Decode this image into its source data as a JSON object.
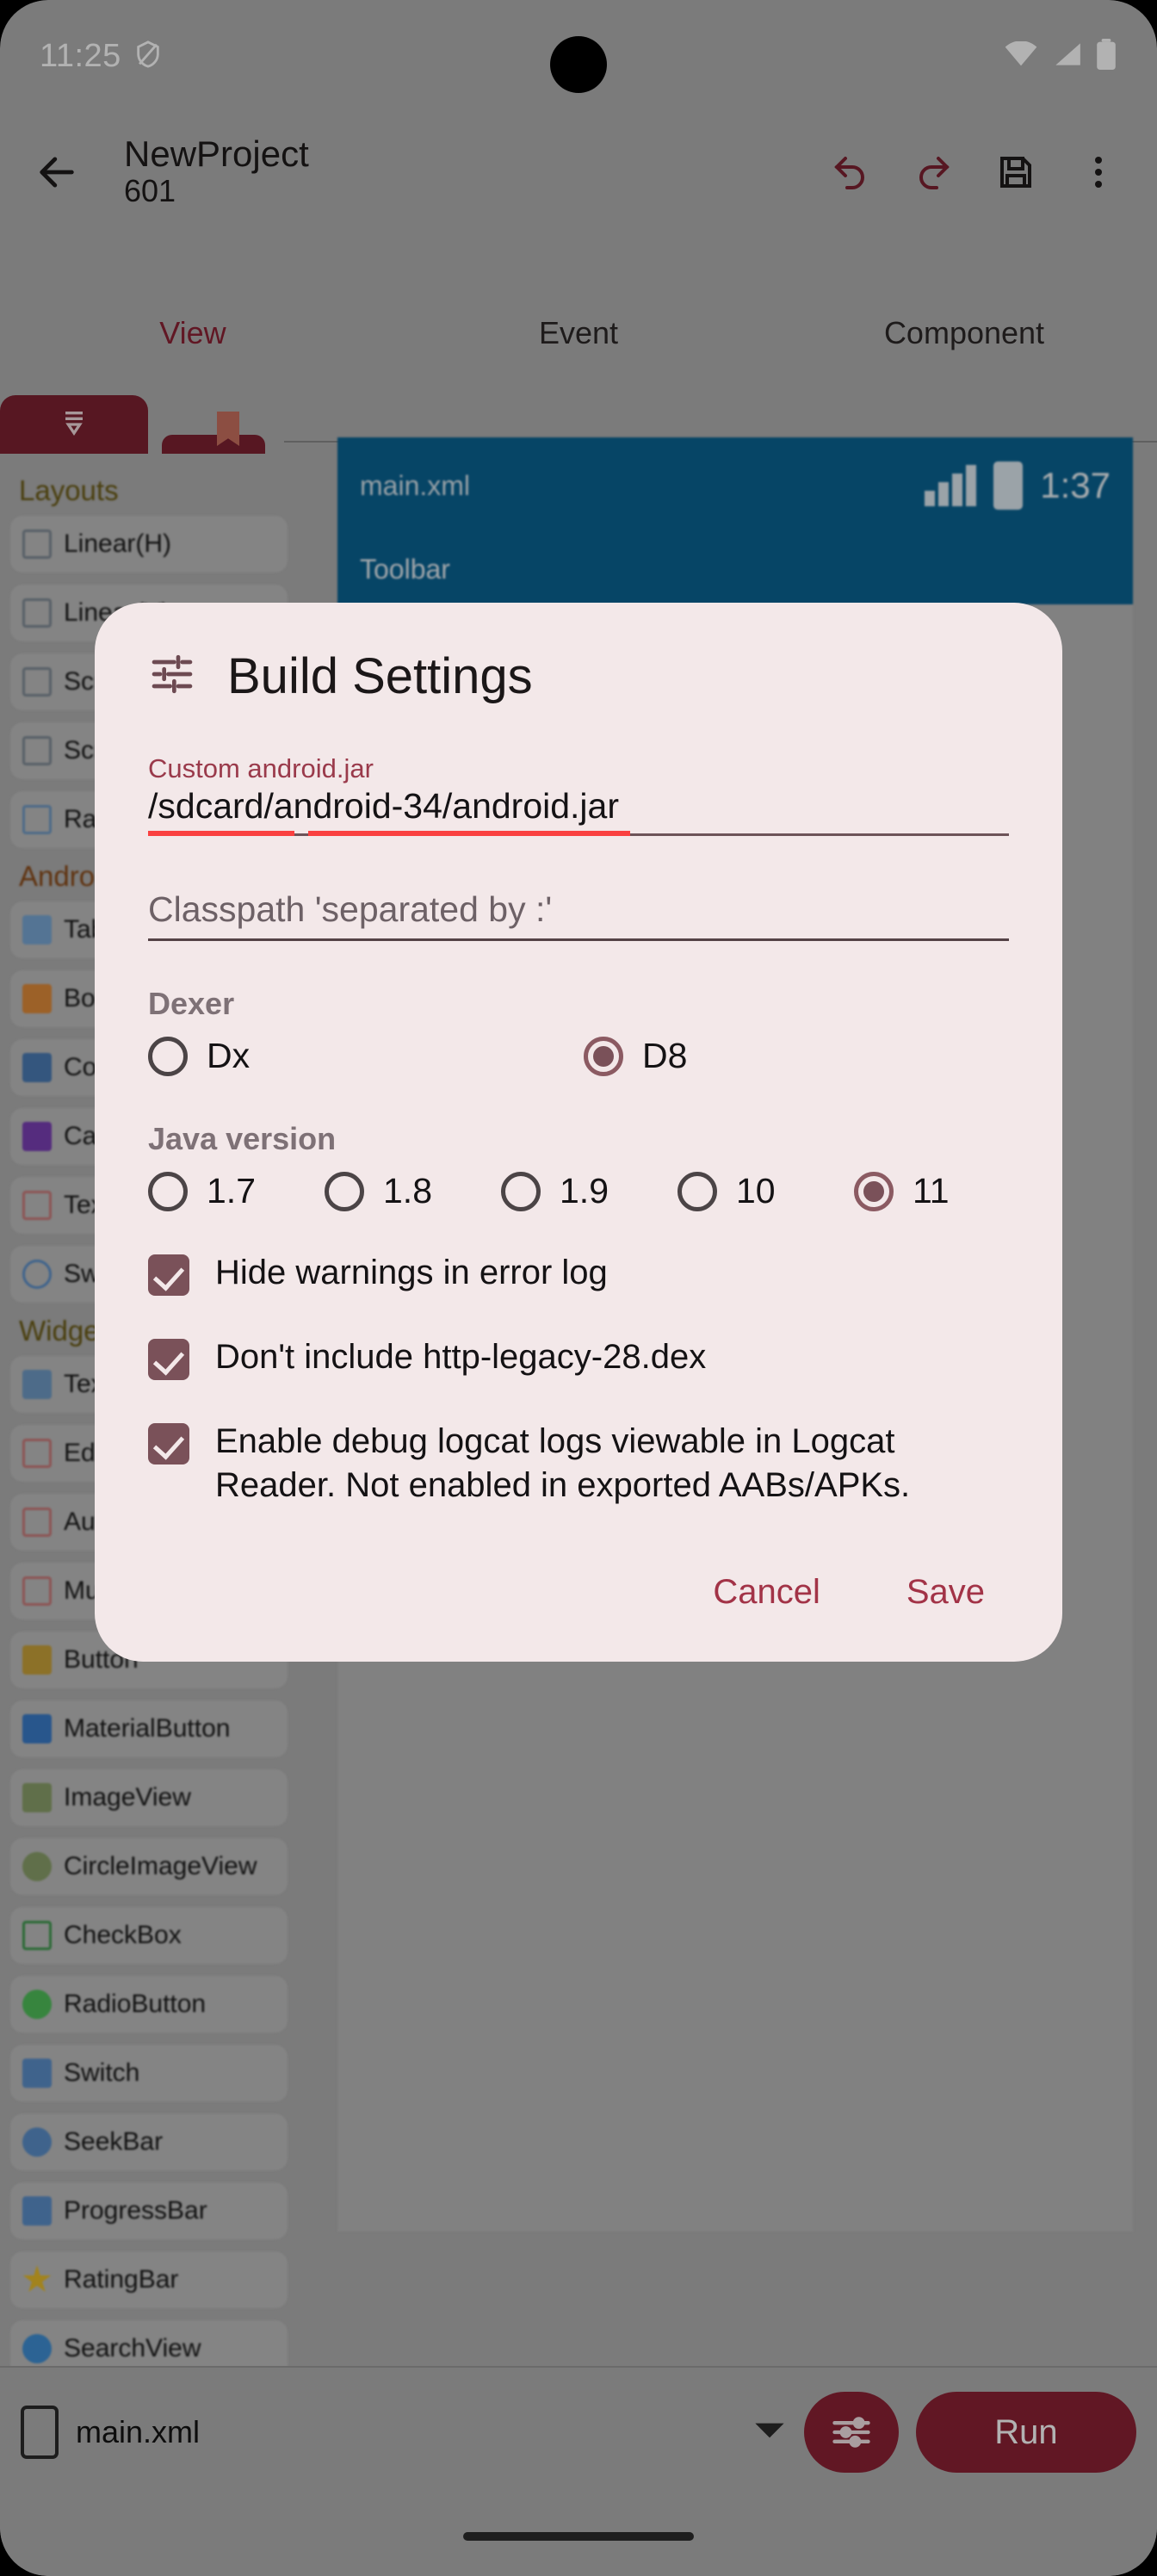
{
  "statusbar": {
    "time": "11:25",
    "shield_icon": "shield-icon",
    "wifi_icon": "wifi-icon",
    "signal_icon": "signal-icon",
    "battery_icon": "battery-icon"
  },
  "toolbar": {
    "back_icon": "back-arrow-icon",
    "project_name": "NewProject",
    "project_sub": "601",
    "undo_icon": "undo-icon",
    "redo_icon": "redo-icon",
    "save_icon": "save-disk-icon",
    "overflow_icon": "more-vert-icon"
  },
  "tabs": [
    {
      "label": "View",
      "active": true
    },
    {
      "label": "Event",
      "active": false
    },
    {
      "label": "Component",
      "active": false
    }
  ],
  "palette": {
    "layouts_header": "Layouts",
    "layouts": [
      {
        "label": "Linear(H)",
        "icon": "linear-horizontal-icon"
      },
      {
        "label": "Linear(V)",
        "icon": "linear-vertical-icon"
      },
      {
        "label": "ScrollView(H)",
        "icon": "scroll-h-icon"
      },
      {
        "label": "ScrollView(V)",
        "icon": "scroll-v-icon"
      },
      {
        "label": "RadioGroup",
        "icon": "radiogroup-icon"
      }
    ],
    "androidx_header": "AndroidX",
    "androidx": [
      {
        "label": "TabLayout",
        "icon": "tab-icon"
      },
      {
        "label": "BottomNavigationView",
        "icon": "home-icon"
      },
      {
        "label": "ComposeView android",
        "icon": "compose-icon"
      },
      {
        "label": "CardView",
        "icon": "card-icon"
      },
      {
        "label": "TextInputLayout",
        "icon": "textinput-icon"
      },
      {
        "label": "SwipeRefreshLayout",
        "icon": "swiperefresh-icon"
      }
    ],
    "widgets_header": "Widgets",
    "widgets": [
      {
        "label": "TextView",
        "icon": "textview-icon"
      },
      {
        "label": "EditText",
        "icon": "edittext-icon"
      },
      {
        "label": "AutoCompleteTextView",
        "icon": "autocomplete-icon"
      },
      {
        "label": "MultiAutoCompleteTextView",
        "icon": "multiautocomplete-icon"
      },
      {
        "label": "Button",
        "icon": "button-icon"
      },
      {
        "label": "MaterialButton",
        "icon": "material-button-icon"
      },
      {
        "label": "ImageView",
        "icon": "imageview-icon"
      },
      {
        "label": "CircleImageView",
        "icon": "circleimage-icon"
      },
      {
        "label": "CheckBox",
        "icon": "checkbox-icon"
      },
      {
        "label": "RadioButton",
        "icon": "radiobutton-icon"
      },
      {
        "label": "Switch",
        "icon": "switch-icon"
      },
      {
        "label": "SeekBar",
        "icon": "seekbar-icon"
      },
      {
        "label": "ProgressBar",
        "icon": "progressbar-icon"
      },
      {
        "label": "RatingBar",
        "icon": "ratingbar-icon"
      },
      {
        "label": "SearchView",
        "icon": "searchview-icon"
      }
    ]
  },
  "preview": {
    "filename": "main.xml",
    "clock": "1:37",
    "toolbar_label": "Toolbar"
  },
  "dialog": {
    "icon": "tune-sliders-icon",
    "title": "Build Settings",
    "custom_jar": {
      "label": "Custom android.jar",
      "value": "/sdcard/android-34/android.jar"
    },
    "classpath": {
      "placeholder": "Classpath 'separated by :'",
      "value": ""
    },
    "dexer": {
      "label": "Dexer",
      "options": [
        {
          "label": "Dx",
          "selected": false
        },
        {
          "label": "D8",
          "selected": true
        }
      ]
    },
    "java_version": {
      "label": "Java version",
      "options": [
        {
          "label": "1.7",
          "selected": false
        },
        {
          "label": "1.8",
          "selected": false
        },
        {
          "label": "1.9",
          "selected": false
        },
        {
          "label": "10",
          "selected": false
        },
        {
          "label": "11",
          "selected": true
        }
      ]
    },
    "checkboxes": [
      {
        "label": "Hide warnings in error log",
        "checked": true
      },
      {
        "label": "Don't include http-legacy-28.dex",
        "checked": true
      },
      {
        "label": "Enable debug logcat logs viewable in Logcat Reader. Not enabled in exported AABs/APKs.",
        "checked": true
      }
    ],
    "cancel_label": "Cancel",
    "save_label": "Save"
  },
  "bottombar": {
    "device_icon": "phone-icon",
    "file_label": "main.xml",
    "dropdown_icon": "chevron-down-icon",
    "settings_icon": "tune-sliders-icon",
    "run_label": "Run"
  },
  "colors": {
    "accent": "#8c2234",
    "dialog_bg": "#f3e8e9",
    "dialog_accent": "#a23347",
    "preview_bar": "#0a6393",
    "error_underline": "#fa4040"
  }
}
